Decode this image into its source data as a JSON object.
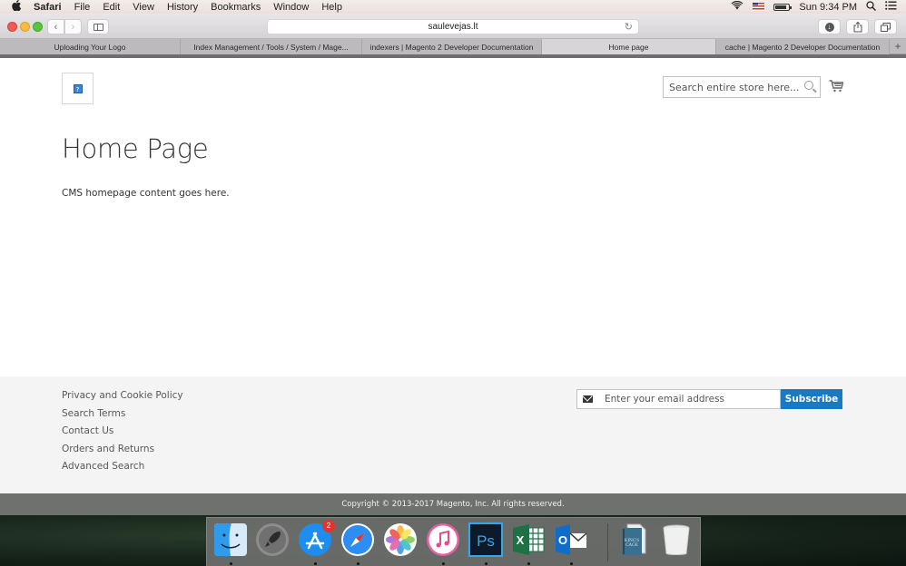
{
  "menubar": {
    "apple": "",
    "items": [
      "Safari",
      "File",
      "Edit",
      "View",
      "History",
      "Bookmarks",
      "Window",
      "Help"
    ],
    "clock": "Sun 9:34 PM"
  },
  "toolbar": {
    "url": "saulevejas.lt"
  },
  "tabs": [
    {
      "label": "Uploading Your Logo",
      "active": false
    },
    {
      "label": "Index Management / Tools / System / Mage...",
      "active": false
    },
    {
      "label": "indexers | Magento 2 Developer Documentation",
      "active": false
    },
    {
      "label": "Home page",
      "active": true
    },
    {
      "label": "cache | Magento 2 Developer Documentation",
      "active": false
    }
  ],
  "page": {
    "search_placeholder": "Search entire store here...",
    "title": "Home Page",
    "content": "CMS homepage content goes here.",
    "footer_links": [
      "Privacy and Cookie Policy",
      "Search Terms",
      "Contact Us",
      "Orders and Returns",
      "Advanced Search"
    ],
    "newsletter_placeholder": "Enter your email address",
    "subscribe_label": "Subscribe",
    "copyright": "Copyright © 2013-2017 Magento, Inc. All rights reserved.",
    "accent_color": "#1979c3"
  },
  "dock": {
    "items": [
      {
        "name": "Finder",
        "running": true
      },
      {
        "name": "Launchpad",
        "running": false
      },
      {
        "name": "App Store",
        "running": true,
        "badge": "2"
      },
      {
        "name": "Safari",
        "running": true
      },
      {
        "name": "Photos",
        "running": false
      },
      {
        "name": "iTunes",
        "running": true
      },
      {
        "name": "Photoshop",
        "running": true
      },
      {
        "name": "Excel",
        "running": true
      },
      {
        "name": "Outlook",
        "running": true
      },
      {
        "name": "Document",
        "running": false
      },
      {
        "name": "Trash",
        "running": false
      }
    ]
  }
}
